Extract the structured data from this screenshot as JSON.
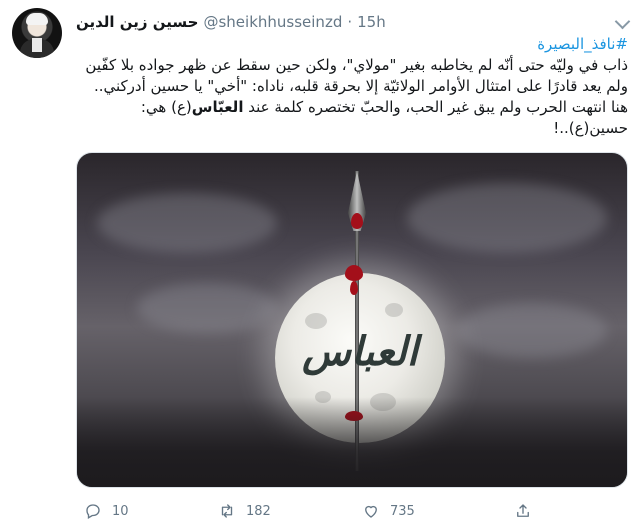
{
  "user": {
    "display_name": "حسين زين الدين",
    "handle": "@sheikhhusseinzd",
    "separator": "·",
    "time": "15h"
  },
  "tweet": {
    "hashtag": "#نافذ_البصيرة",
    "line1": "ذاب في وليّه حتى أنّه لم يخاطبه بغير \"مولاي\"، ولكن حين سقط عن ظهر جواده بلا كفّين ولم يعد قادرًا على امتثال الأوامر الولائيّة إلا بحرقة قلبه، ناداه: \"أخي\" يا حسين أدركني..",
    "line2_before": "هنا انتهت الحرب ولم يبق غير الحب، والحبّ تختصره كلمة عند ",
    "line2_bold": "العبّاس",
    "line2_after": "(ع) هي:",
    "line3": "حسين(ع)..!"
  },
  "media": {
    "calligraphy": "العباس"
  },
  "actions": {
    "reply_count": "10",
    "retweet_count": "182",
    "like_count": "735"
  },
  "icons": [
    "reply-icon",
    "retweet-icon",
    "like-icon",
    "share-icon",
    "chevron-down-icon"
  ],
  "colors": {
    "link": "#1b95e0",
    "muted": "#657786"
  }
}
